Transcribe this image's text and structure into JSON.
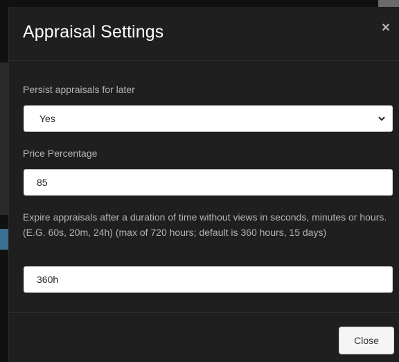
{
  "dialog": {
    "title": "Appraisal Settings",
    "close_icon": "close-icon",
    "close_glyph": "×"
  },
  "fields": {
    "persist": {
      "label": "Persist appraisals for later",
      "value": "Yes"
    },
    "price_percentage": {
      "label": "Price Percentage",
      "value": "85"
    },
    "expire": {
      "label": "Expire appraisals after a duration of time without views in seconds, minutes or hours. (E.G. 60s, 20m, 24h) (max of 720 hours; default is 360 hours, 15 days)",
      "value": "360h"
    }
  },
  "footer": {
    "close_label": "Close"
  },
  "colors": {
    "modal_background": "#1f1f1f",
    "title_text": "#ffffff",
    "label_text": "#b4b4b4",
    "input_background": "#ffffff"
  }
}
